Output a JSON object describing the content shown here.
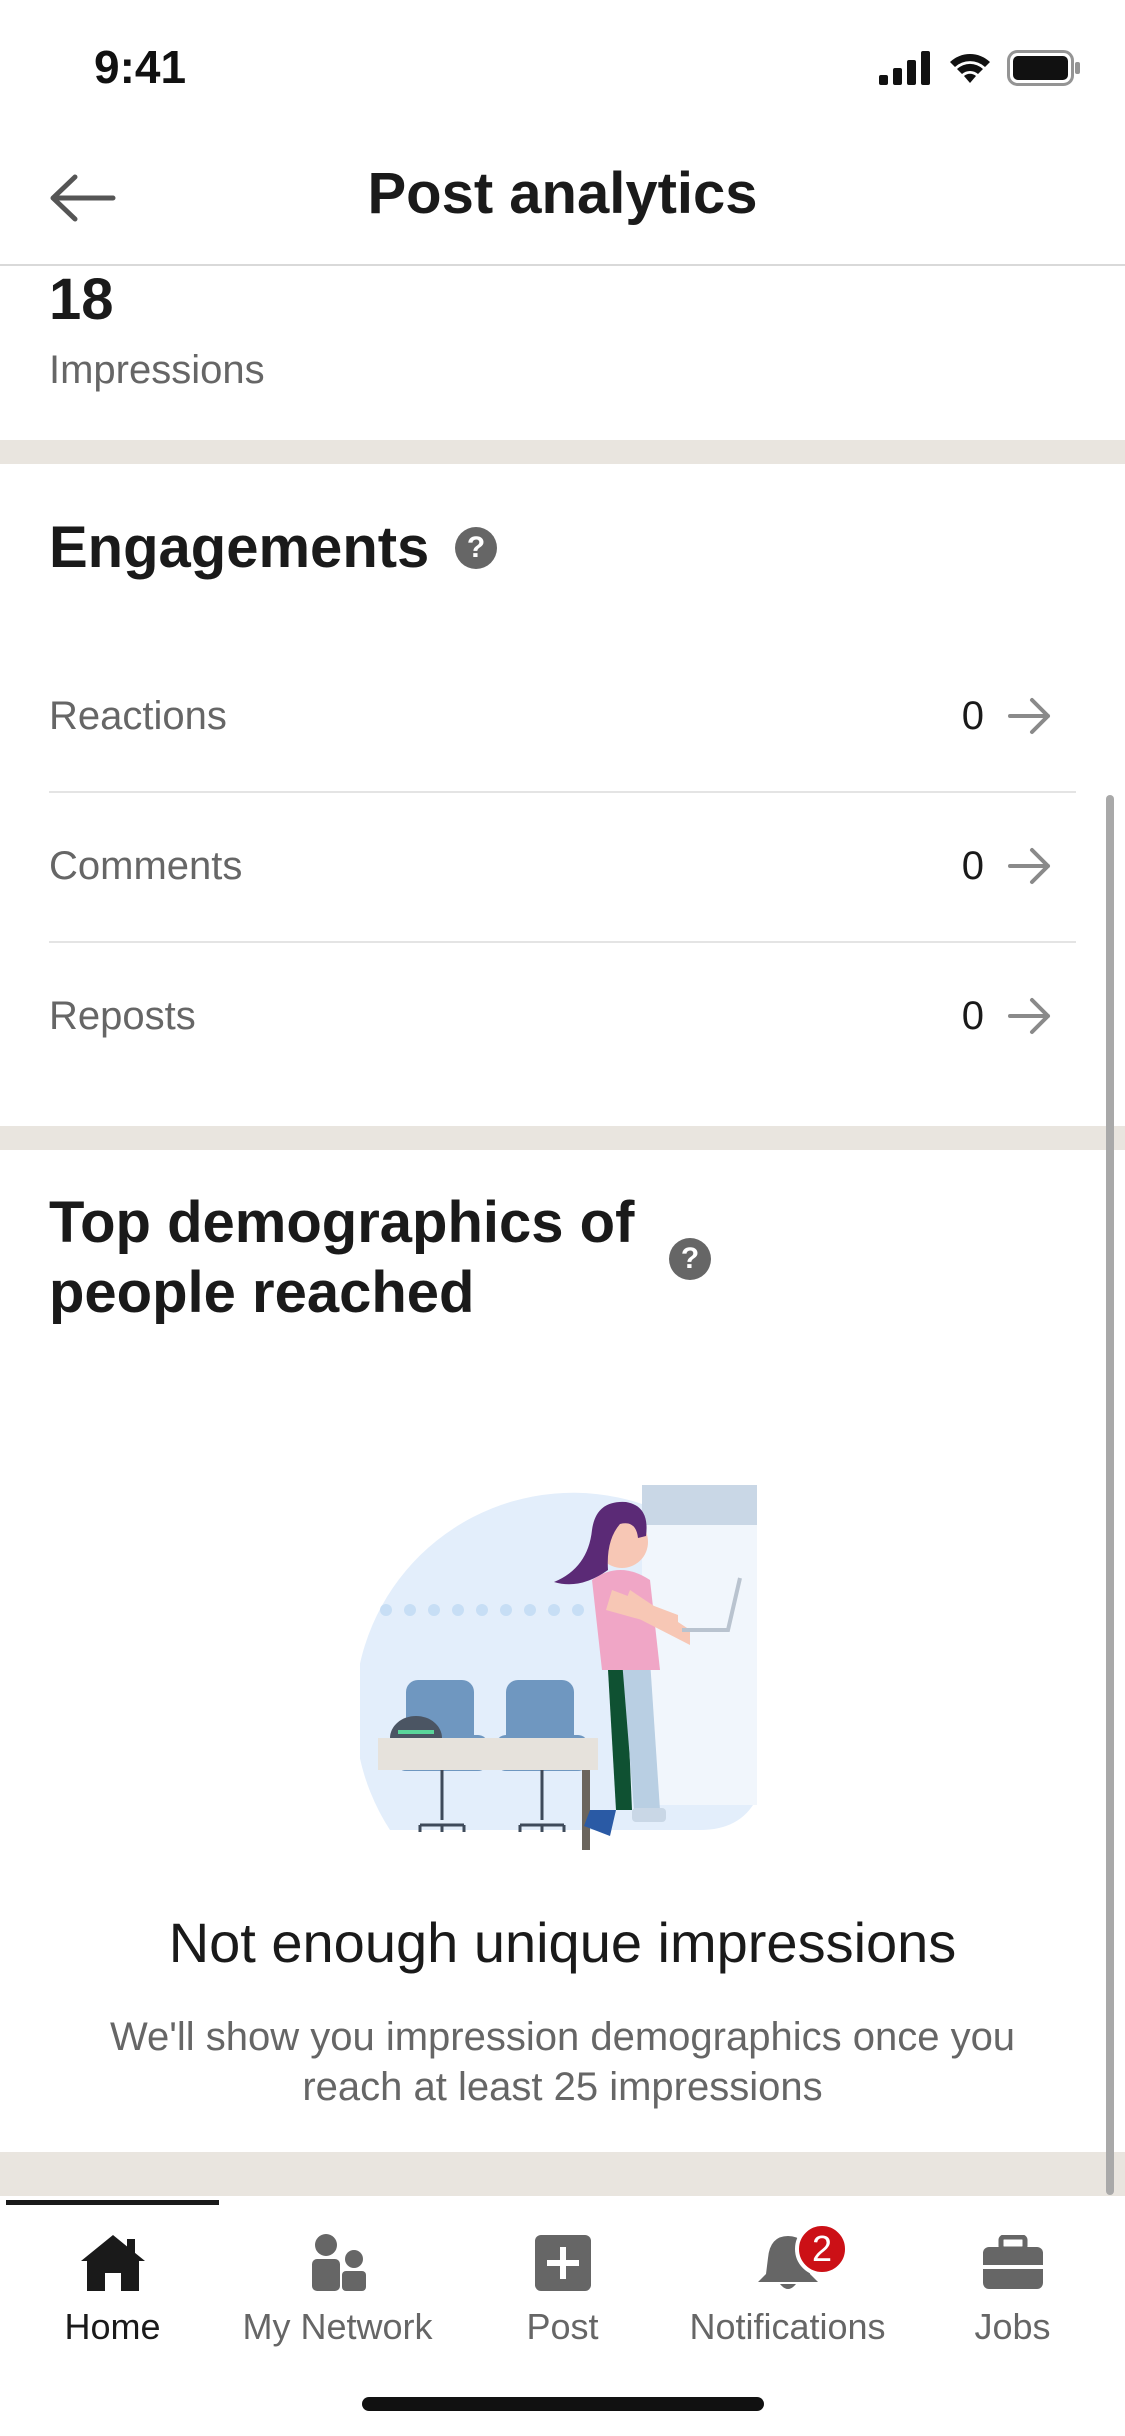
{
  "status_bar": {
    "time": "9:41"
  },
  "header": {
    "title": "Post analytics",
    "back_icon": "arrow-left-icon"
  },
  "impressions": {
    "value": "18",
    "label": "Impressions"
  },
  "engagements": {
    "title": "Engagements",
    "help_icon": "?",
    "rows": [
      {
        "label": "Reactions",
        "value": "0"
      },
      {
        "label": "Comments",
        "value": "0"
      },
      {
        "label": "Reposts",
        "value": "0"
      }
    ]
  },
  "demographics": {
    "title_line1": "Top demographics of",
    "title_line2": "people reached",
    "help_icon": "?",
    "empty_title": "Not enough unique impressions",
    "empty_desc_line1": "We'll show you impression demographics once you",
    "empty_desc_line2": "reach at least 25 impressions"
  },
  "tabbar": {
    "tabs": [
      {
        "label": "Home",
        "icon": "home-icon",
        "active": true
      },
      {
        "label": "My Network",
        "icon": "network-icon",
        "active": false
      },
      {
        "label": "Post",
        "icon": "post-icon",
        "active": false
      },
      {
        "label": "Notifications",
        "icon": "bell-icon",
        "active": false,
        "badge": "2"
      },
      {
        "label": "Jobs",
        "icon": "briefcase-icon",
        "active": false
      }
    ]
  },
  "colors": {
    "divider_band": "#e9e5df",
    "badge": "#cc1016",
    "muted_text": "#666666"
  }
}
